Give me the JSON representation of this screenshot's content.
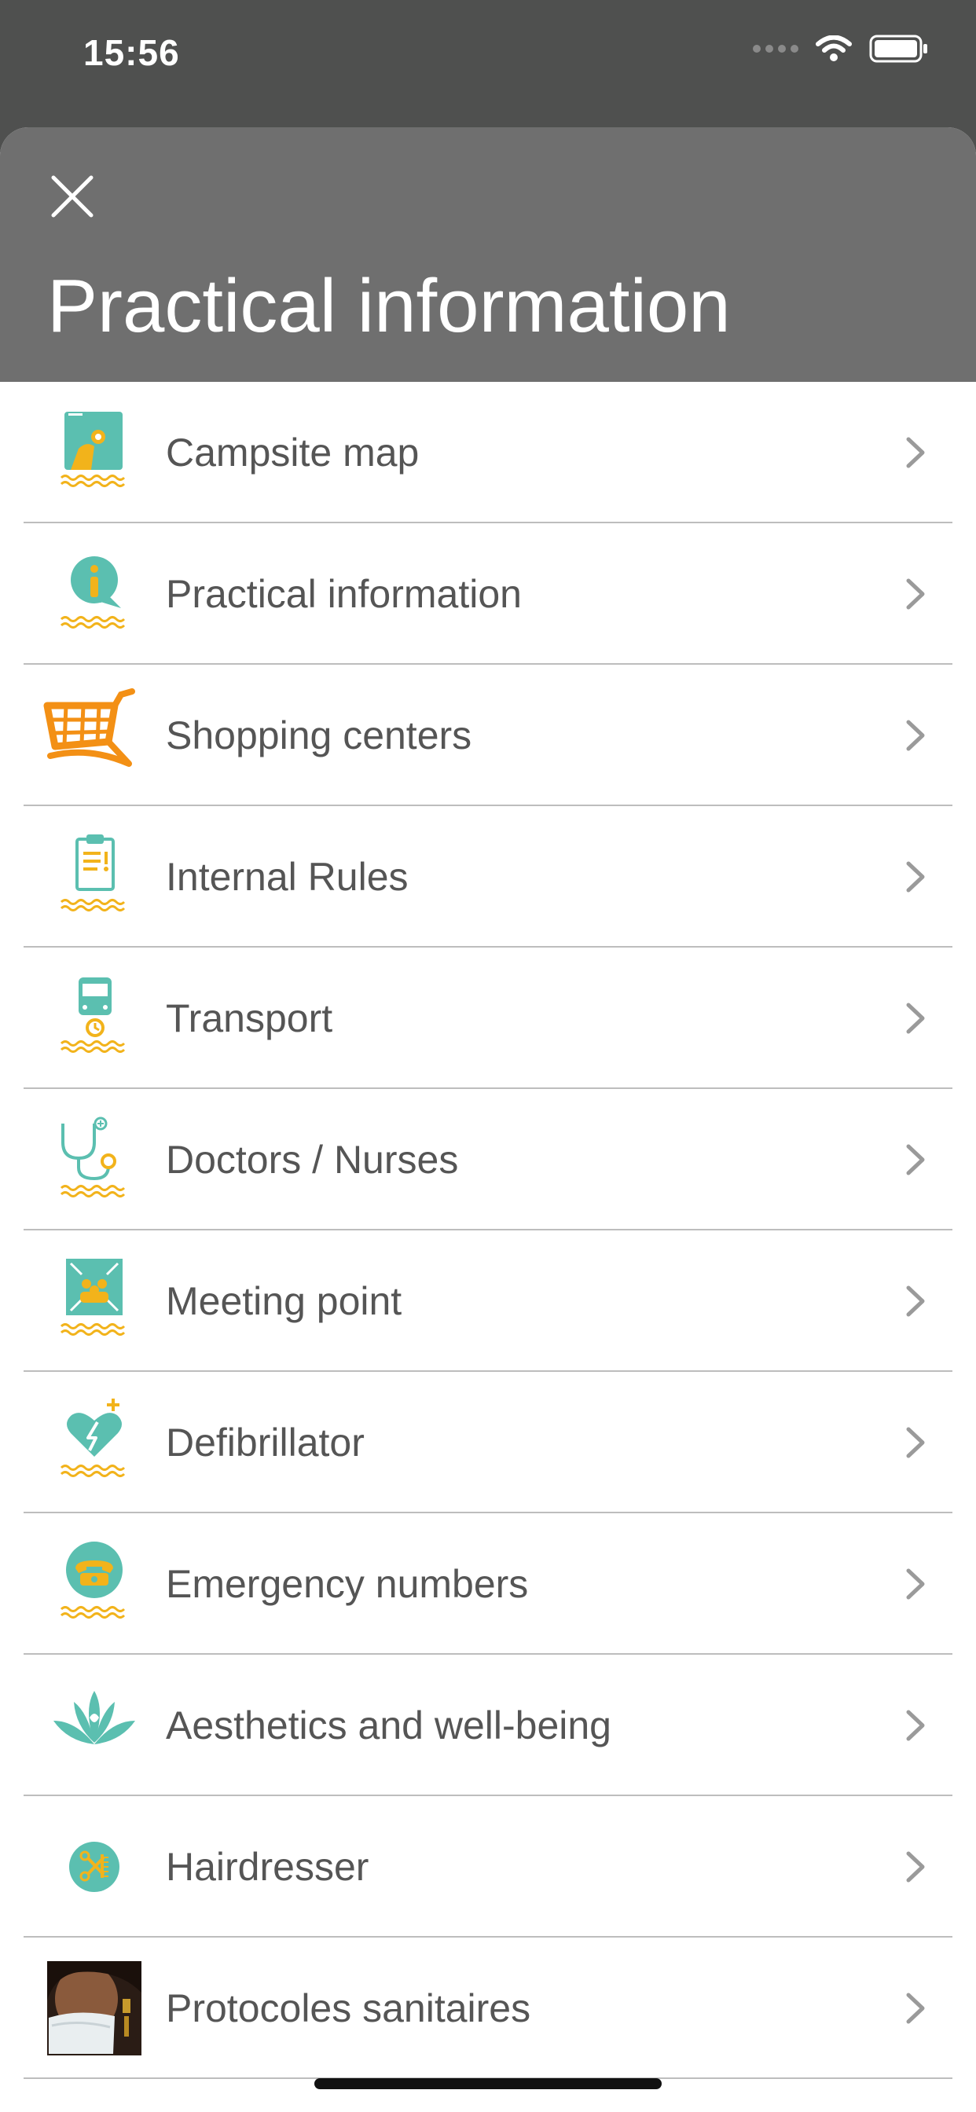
{
  "status_bar": {
    "time": "15:56"
  },
  "header": {
    "title": "Practical information",
    "close_icon": "close-icon"
  },
  "colors": {
    "teal": "#5bbfb0",
    "yellow": "#f2b31b",
    "orange": "#f39015",
    "header_bg": "#6f6f6f",
    "text": "#555555"
  },
  "menu_items": [
    {
      "label": "Campsite map",
      "icon": "map-icon"
    },
    {
      "label": "Practical information",
      "icon": "info-bubble-icon"
    },
    {
      "label": "Shopping centers",
      "icon": "shopping-cart-icon"
    },
    {
      "label": "Internal Rules",
      "icon": "clipboard-icon"
    },
    {
      "label": "Transport",
      "icon": "bus-icon"
    },
    {
      "label": "Doctors / Nurses",
      "icon": "stethoscope-icon"
    },
    {
      "label": "Meeting point",
      "icon": "meeting-point-icon"
    },
    {
      "label": "Defibrillator",
      "icon": "defibrillator-icon"
    },
    {
      "label": "Emergency numbers",
      "icon": "telephone-icon"
    },
    {
      "label": "Aesthetics and well-being",
      "icon": "lotus-icon"
    },
    {
      "label": "Hairdresser",
      "icon": "scissors-icon"
    },
    {
      "label": "Protocoles sanitaires",
      "icon": "masked-person-photo"
    }
  ]
}
